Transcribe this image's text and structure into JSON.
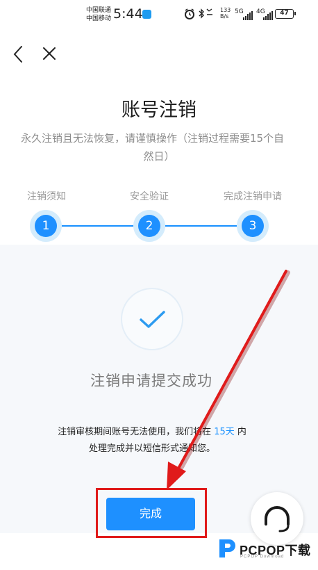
{
  "status_bar": {
    "carrier_1": "中国联通",
    "carrier_2": "中国移动",
    "time": "5:44",
    "net_speed_value": "133",
    "net_speed_unit": "B/s",
    "network_1": "5G",
    "network_2": "4G",
    "battery": "47"
  },
  "page": {
    "title": "账号注销",
    "subtitle_line_1": "永久注销且无法恢复，请谨慎操作（注销过程需要15个自",
    "subtitle_line_2": "然日）"
  },
  "steps": [
    {
      "label": "注销须知",
      "number": "1"
    },
    {
      "label": "安全验证",
      "number": "2"
    },
    {
      "label": "完成注销申请",
      "number": "3"
    }
  ],
  "result": {
    "title": "注销申请提交成功",
    "notice_prefix": "注销审核期间账号无法使用，我们将在 ",
    "notice_days": "15天",
    "notice_suffix": " 内",
    "notice_line_2": "处理完成并以短信形式通知您。"
  },
  "done_button": "完成",
  "watermark": {
    "brand": "PCPOP下载",
    "sub": "PCPOP Download"
  },
  "colors": {
    "accent": "#1e90ff",
    "step_halo": "#d4ecfc",
    "annotation_red": "#e01b1b",
    "check_mark": "#2d9bf0"
  }
}
